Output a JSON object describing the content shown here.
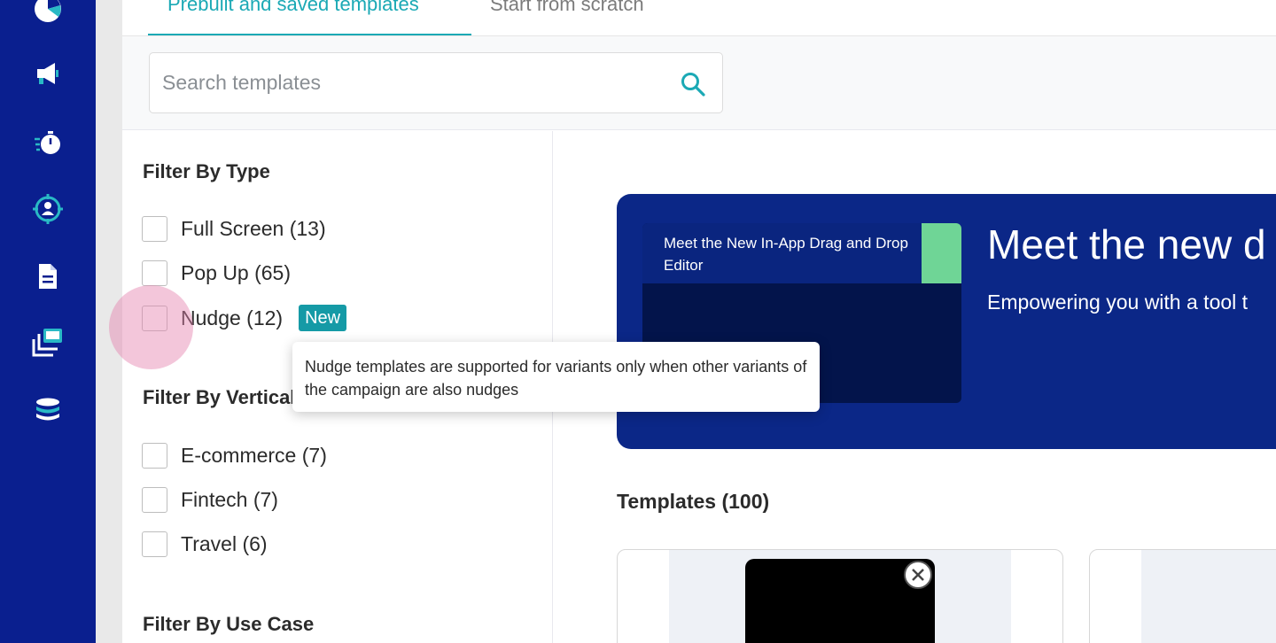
{
  "sidebar": {
    "items": [
      {
        "icon": "pie-chart-icon"
      },
      {
        "icon": "megaphone-icon"
      },
      {
        "icon": "stopwatch-icon"
      },
      {
        "icon": "target-user-icon"
      },
      {
        "icon": "document-icon"
      },
      {
        "icon": "stacked-screens-icon"
      },
      {
        "icon": "database-icon"
      }
    ]
  },
  "tabs": [
    {
      "label": "Prebuilt and saved templates",
      "active": true
    },
    {
      "label": "Start from scratch",
      "active": false
    }
  ],
  "search": {
    "placeholder": "Search templates",
    "value": ""
  },
  "filters": {
    "type_heading": "Filter By Type",
    "type_options": [
      {
        "label": "Full Screen (13)",
        "checked": false
      },
      {
        "label": "Pop Up (65)",
        "checked": false
      },
      {
        "label": "Nudge (12)",
        "checked": false,
        "badge": "New"
      }
    ],
    "vertical_heading": "Filter By Vertical",
    "vertical_options": [
      {
        "label": "E-commerce (7)",
        "checked": false
      },
      {
        "label": "Fintech (7)",
        "checked": false
      },
      {
        "label": "Travel (6)",
        "checked": false
      }
    ],
    "use_case_heading": "Filter By Use Case"
  },
  "tooltip": {
    "text": "Nudge templates are supported for variants only when other variants of the campaign are also nudges"
  },
  "banner": {
    "card_text": "Meet the New In-App Drag and Drop Editor",
    "title": "Meet the new d",
    "subtitle": "Empowering you with a tool t"
  },
  "templates": {
    "heading": "Templates (100)"
  },
  "colors": {
    "sidebar": "#0a1f8f",
    "accent": "#1ba9b5",
    "badge": "#159aa6",
    "banner": "#0b2787",
    "banner_green": "#6fd596"
  }
}
